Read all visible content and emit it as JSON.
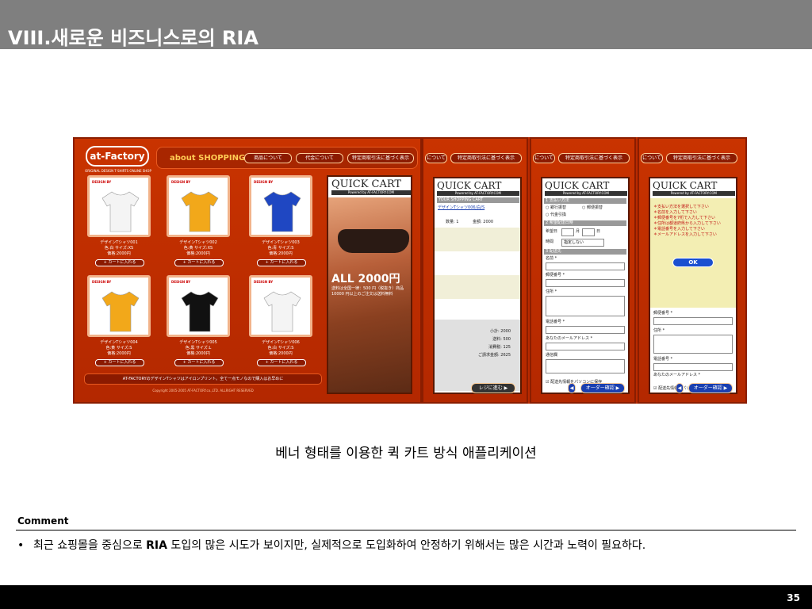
{
  "slide": {
    "title": "VIII.새로운 비즈니스로의 RIA",
    "caption": "베너 형태를 이용한 퀵 카트 방식 애플리케이션",
    "comment_label": "Comment",
    "comment_bullet": "•",
    "comment_pre": "최근 쇼핑몰을 중심으로 ",
    "comment_bold": "RIA",
    "comment_post": " 도입의 많은 시도가 보이지만, 실제적으로 도입화하여 안정하기 위해서는 많은 시간과 노력이 필요하다.",
    "page_number": "35"
  },
  "shop": {
    "logo": "at-Factory",
    "logo_sub": "ORIGINAL DESIGN T-SHIRTS ONLINE SHOP",
    "about": "about SHOPPING ►",
    "nav": [
      "商品について",
      "代金について",
      "特定商取引法に基づく表示"
    ],
    "products": [
      {
        "name": "デザインTシャツ001",
        "spec": "色:白 サイズ:XS",
        "price": "価格:2000円",
        "add": "+ カートに入れる",
        "color": "#f4f4f4"
      },
      {
        "name": "デザインTシャツ002",
        "spec": "色:黄 サイズ:XS",
        "price": "価格:2000円",
        "add": "+ カートに入れる",
        "color": "#f2a81a"
      },
      {
        "name": "デザインTシャツ003",
        "spec": "色:青 サイズ:S",
        "price": "価格:2000円",
        "add": "+ カートに入れる",
        "color": "#1f47c2"
      },
      {
        "name": "デザインTシャツ004",
        "spec": "色:黄 サイズ:S",
        "price": "価格:2000円",
        "add": "+ カートに入れる",
        "color": "#f2a81a"
      },
      {
        "name": "デザインTシャツ005",
        "spec": "色:黒 サイズ:L",
        "price": "価格:2000円",
        "add": "+ カートに入れる",
        "color": "#111111"
      },
      {
        "name": "デザインTシャツ006",
        "spec": "色:白 サイズ:S",
        "price": "価格:2000円",
        "add": "+ カートに入れる",
        "color": "#f4f4f4"
      }
    ],
    "badge": "DESIGN BY",
    "quick_cart": "QUICK CART",
    "powered": "Powered by AT-FACTORY.COM",
    "price": "ALL 2000円",
    "price_sub": "送料は全国一律：500 円（税抜き）商品 10000 円以上のご注文は送料無料",
    "banner": "AT-FACTORYのデザインTシャツはアイロンプリント。全て一点モノなので購入はお早めに",
    "copyright": "Copyright 2005-2005 AT-FACTORY.co.,LTD. ALLRIGHT RESERVED"
  },
  "cart1": {
    "nav": [
      "について",
      "特定商取引法に基づく表示"
    ],
    "quick_cart": "QUICK CART",
    "powered": "Powered by AT-FACTORY.COM",
    "your_cart": "YOUR SHOPPING CART",
    "item_link": "デザインTシャツ006/白/S",
    "qty": "数量: 1",
    "amount": "金額: 2000",
    "subtotal": "小計: 2000",
    "shipping": "送料: 500",
    "tax": "消費税: 125",
    "total": "ご請求金額: 2625",
    "checkout": "レジに進む ▶"
  },
  "cart2": {
    "nav": [
      "について",
      "特定商取引法に基づく表示"
    ],
    "quick_cart": "QUICK CART",
    "powered": "Powered by AT-FACTORY.COM",
    "s1": "1 支払い方法",
    "pay1": "○ 銀行振替",
    "pay2": "○ 郵便振替",
    "pay3": "○ 代金引換",
    "s2": "2 希望配達日時",
    "date_label": "希望日",
    "month": "月",
    "day": "日",
    "time_label": "時間",
    "time_value": "指定しない",
    "s3": "3 配送先",
    "f_name": "名前 *",
    "f_zip": "郵便番号 *",
    "f_addr": "住所 *",
    "f_tel": "電話番号 *",
    "f_mail": "あなたのメールアドレス *",
    "f_note": "通信欄",
    "save": "☑ 配送先情報をパソコンに保存",
    "back": "◀",
    "confirm": "オーダー確認 ▶"
  },
  "cart3": {
    "nav": [
      "について",
      "特定商取引法に基づく表示"
    ],
    "quick_cart": "QUICK CART",
    "powered": "Powered by AT-FACTORY.COM",
    "errors": [
      "＊支払い方法を選択して下さい",
      "＊名前を入力して下さい",
      "＊郵便番号を7桁で入力して下さい",
      "＊住所は都道府県から入力して下さい",
      "＊電話番号を入力して下さい",
      "＊メールアドレスを入力して下さい"
    ],
    "ok": "OK",
    "f_zip": "郵便番号 *",
    "f_addr": "住所 *",
    "f_tel": "電話番号 *",
    "f_mail": "あなたのメールアドレス *",
    "f_note": "通信欄",
    "save": "☑ 配送先情報をパソコンに保存",
    "back": "◀",
    "confirm": "オーダー確認 ▶"
  }
}
